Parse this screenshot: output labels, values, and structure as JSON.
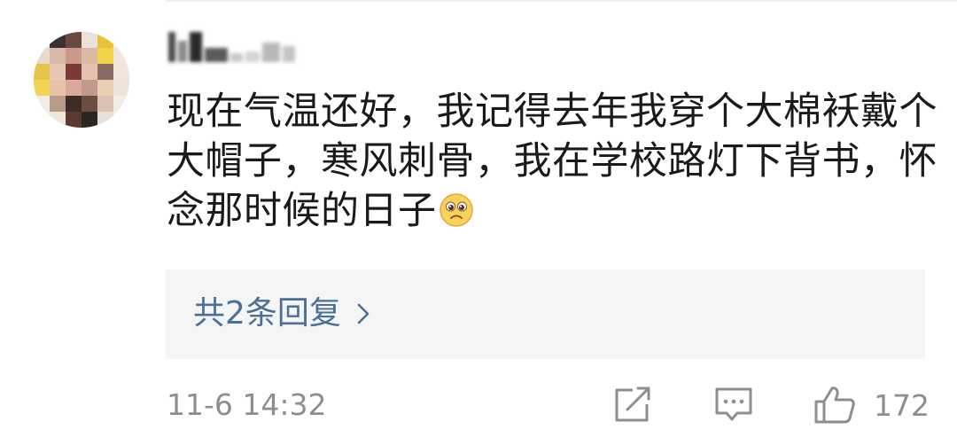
{
  "comment": {
    "username": "",
    "text": "现在气温还好，我记得去年我穿个大棉袄戴个大帽子，寒风刺骨，我在学校路灯下背书，怀念那时候的日子",
    "emoji": "pleading-face-icon",
    "replies_label": "共2条回复",
    "timestamp": "11-6 14:32",
    "like_count": "172"
  },
  "icons": {
    "share": "edit-share-icon",
    "reply": "comment-icon",
    "like": "thumbs-up-icon",
    "chevron": "chevron-right-icon"
  },
  "colors": {
    "text": "#1a1a1a",
    "link": "#4c6f95",
    "muted": "#8e8e8e",
    "reply_bg": "#f5f5f5"
  }
}
